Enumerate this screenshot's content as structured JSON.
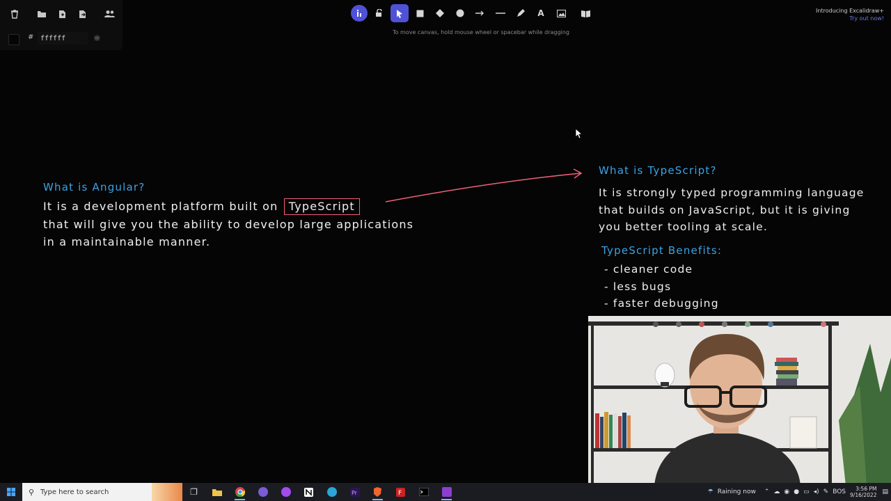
{
  "menu": {
    "hex_value": "ffffff",
    "hash": "#"
  },
  "toolbar": {
    "hint": "To move canvas, hold mouse wheel or spacebar while dragging",
    "active_tool": "selection"
  },
  "promo": {
    "line1": "Introducing Excalidraw+",
    "line2": "Try out now!"
  },
  "canvas": {
    "angular_title": "What is Angular?",
    "angular_line1_prefix": "It is a development platform built on",
    "angular_highlight": "TypeScript",
    "angular_line2": "that will give you the ability to develop large applications",
    "angular_line3": "in a maintainable manner.",
    "ts_title": "What is TypeScript?",
    "ts_line1": "It is strongly typed programming language",
    "ts_line2": "that builds on JavaScript, but it is giving",
    "ts_line3": "you better tooling at scale.",
    "benefits_title": "TypeScript Benefits:",
    "benefits": [
      "- cleaner code",
      "- less bugs",
      "- faster debugging"
    ],
    "colors": {
      "title": "#3aa3e6",
      "text": "#efefef",
      "accent": "#f2607a",
      "background": "#050505"
    }
  },
  "taskbar": {
    "search_placeholder": "Type here to search",
    "weather": "Raining now",
    "lang": "BOS",
    "time": "3:56 PM",
    "date": "9/16/2022"
  }
}
